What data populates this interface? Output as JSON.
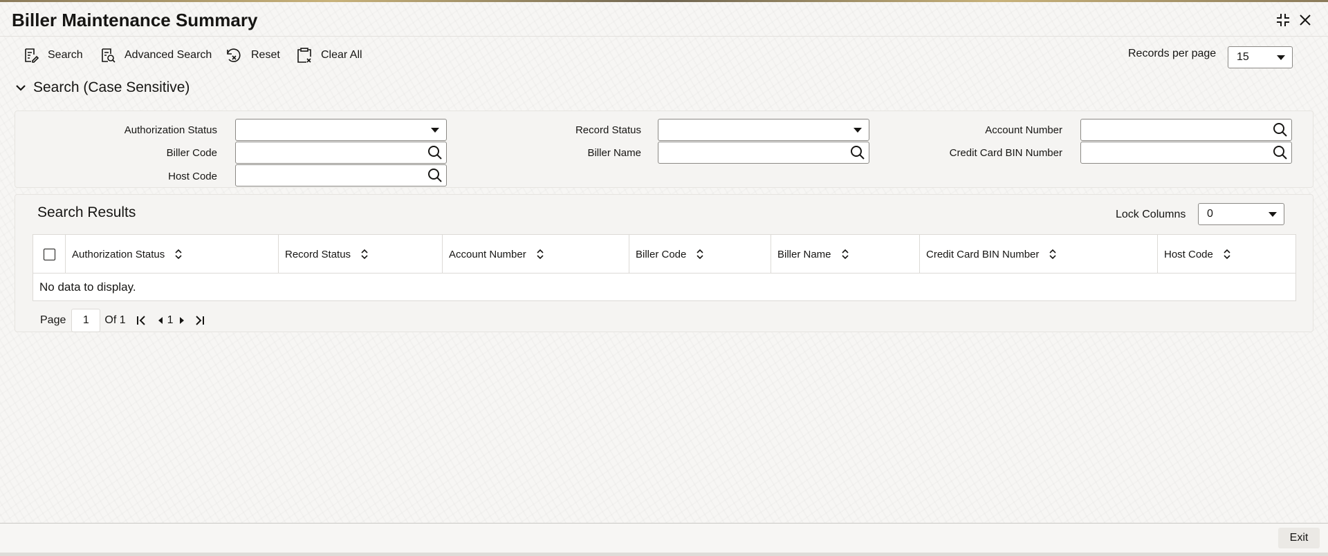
{
  "window": {
    "title": "Biller Maintenance Summary"
  },
  "toolbar": {
    "search_label": "Search",
    "advanced_search_label": "Advanced Search",
    "reset_label": "Reset",
    "clear_all_label": "Clear All",
    "records_per_page_label": "Records per page",
    "records_per_page_value": "15"
  },
  "search_section": {
    "title": "Search (Case Sensitive)",
    "fields": {
      "authorization_status": {
        "label": "Authorization Status",
        "value": ""
      },
      "record_status": {
        "label": "Record Status",
        "value": ""
      },
      "account_number": {
        "label": "Account Number",
        "value": ""
      },
      "biller_code": {
        "label": "Biller Code",
        "value": ""
      },
      "biller_name": {
        "label": "Biller Name",
        "value": ""
      },
      "credit_card_bin_number": {
        "label": "Credit Card BIN Number",
        "value": ""
      },
      "host_code": {
        "label": "Host Code",
        "value": ""
      }
    }
  },
  "results": {
    "title": "Search Results",
    "lock_columns_label": "Lock Columns",
    "lock_columns_value": "0",
    "columns": [
      "Authorization Status",
      "Record Status",
      "Account Number",
      "Biller Code",
      "Biller Name",
      "Credit Card BIN Number",
      "Host Code"
    ],
    "rows": [],
    "empty_message": "No data to display."
  },
  "pagination": {
    "page_label": "Page",
    "current_page": "1",
    "of_label": "Of 1",
    "page_number": "1"
  },
  "footer": {
    "exit_label": "Exit"
  },
  "icons": {
    "search": "search-icon",
    "advanced_search": "advanced-search-icon",
    "reset": "reset-icon",
    "clear_all": "clear-all-icon",
    "collapse": "chevron-down-icon",
    "field_lookup": "search-icon",
    "sort": "sort-icon",
    "first_page": "first-page-icon",
    "previous_page": "previous-page-icon",
    "next_page": "next-page-icon",
    "last_page": "last-page-icon",
    "minimize": "minimize-icon",
    "close": "close-icon"
  }
}
